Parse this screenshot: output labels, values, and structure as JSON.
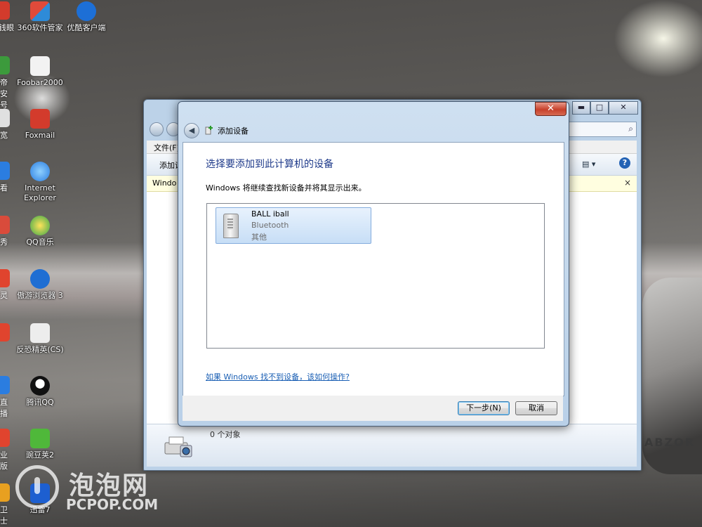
{
  "desktop": {
    "icons": [
      {
        "label": "360软件管家",
        "color": "#2e8bd8"
      },
      {
        "label": "优酷客户端",
        "color": "#1d6fd6"
      },
      {
        "label": "Foobar2000",
        "color": "#d9d9d9"
      },
      {
        "label": "Foxmail",
        "color": "#d33b2c"
      },
      {
        "label": "Internet Explorer",
        "color": "#2b7de0"
      },
      {
        "label": "QQ音乐",
        "color": "#3aa64a"
      },
      {
        "label": "傲游浏览器 3",
        "color": "#1f6ed3"
      },
      {
        "label": "反恐精英(CS)",
        "color": "#6a6a6a"
      },
      {
        "label": "腾讯QQ",
        "color": "#111111"
      },
      {
        "label": "豌豆荚2",
        "color": "#4fb83a"
      },
      {
        "label": "迅雷7",
        "color": "#1d5fd0"
      }
    ],
    "partial_labels": [
      "钱眼",
      "帝安号",
      "宽",
      "看",
      "秀",
      "灵",
      "",
      "直播",
      "业版",
      "卫士"
    ]
  },
  "explorer": {
    "menu_first": "文件(F)",
    "toolbar_label": "添加设",
    "infobar_text": "Windo",
    "infobar_close": "×",
    "search_icon": "magnifier-icon",
    "help_glyph": "?",
    "status_count": "0 个对象",
    "controls": {
      "minimize": "▬",
      "maximize": "□",
      "close": "✕"
    }
  },
  "dialog": {
    "title": "添加设备",
    "close_glyph": "✕",
    "back_glyph": "◀",
    "heading": "选择要添加到此计算机的设备",
    "subtitle": "Windows 将继续查找新设备并将其显示出来。",
    "devices": [
      {
        "name": "BALL iball",
        "type": "Bluetooth",
        "category": "其他"
      }
    ],
    "help_link": "如果 Windows 找不到设备，该如何操作?",
    "buttons": {
      "next": "下一步(N)",
      "cancel": "取消"
    }
  },
  "watermark": {
    "cn": "泡泡网",
    "en": "PCPOP.COM"
  },
  "wallpaper": {
    "shoe_text": "ABZOR"
  }
}
